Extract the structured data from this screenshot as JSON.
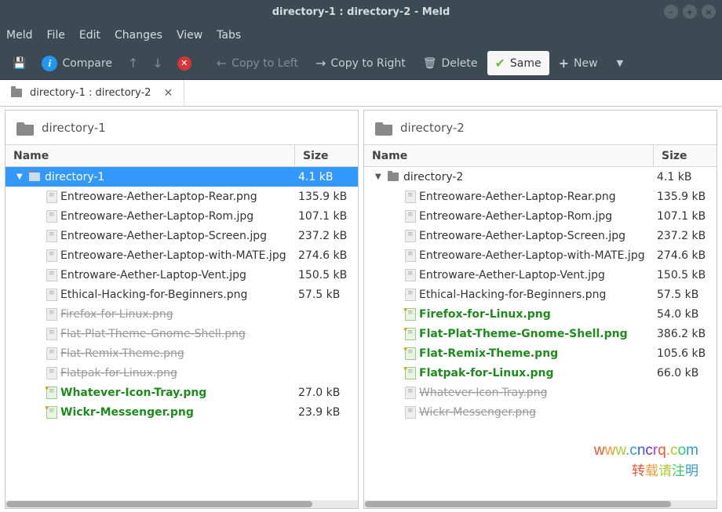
{
  "window": {
    "title": "directory-1 : directory-2 - Meld"
  },
  "menubar": {
    "items": [
      "Meld",
      "File",
      "Edit",
      "Changes",
      "View",
      "Tabs"
    ]
  },
  "toolbar": {
    "compare": "Compare",
    "copy_left": "Copy to Left",
    "copy_right": "Copy to Right",
    "delete": "Delete",
    "same": "Same",
    "new": "New"
  },
  "tab": {
    "label": "directory-1 : directory-2"
  },
  "panels": {
    "left": {
      "header": "directory-1",
      "cols": {
        "name": "Name",
        "size": "Size"
      },
      "root": {
        "name": "directory-1",
        "size": "4.1 kB"
      },
      "files": [
        {
          "name": "Entreoware-Aether-Laptop-Rear.png",
          "size": "135.9 kB",
          "state": "same"
        },
        {
          "name": "Entreoware-Aether-Laptop-Rom.jpg",
          "size": "107.1 kB",
          "state": "same"
        },
        {
          "name": "Entreoware-Aether-Laptop-Screen.jpg",
          "size": "237.2 kB",
          "state": "same"
        },
        {
          "name": "Entreoware-Aether-Laptop-with-MATE.jpg",
          "size": "274.6 kB",
          "state": "same"
        },
        {
          "name": "Entroware-Aether-Laptop-Vent.jpg",
          "size": "150.5 kB",
          "state": "same"
        },
        {
          "name": "Ethical-Hacking-for-Beginners.png",
          "size": "57.5 kB",
          "state": "same"
        },
        {
          "name": "Firefox-for-Linux.png",
          "size": "",
          "state": "deleted"
        },
        {
          "name": "Flat-Plat-Theme-Gnome-Shell.png",
          "size": "",
          "state": "deleted"
        },
        {
          "name": "Flat-Remix-Theme.png",
          "size": "",
          "state": "deleted"
        },
        {
          "name": "Flatpak-for-Linux.png",
          "size": "",
          "state": "deleted"
        },
        {
          "name": "Whatever-Icon-Tray.png",
          "size": "27.0 kB",
          "state": "new"
        },
        {
          "name": "Wickr-Messenger.png",
          "size": "23.9 kB",
          "state": "new"
        }
      ]
    },
    "right": {
      "header": "directory-2",
      "cols": {
        "name": "Name",
        "size": "Size"
      },
      "root": {
        "name": "directory-2",
        "size": "4.1 kB"
      },
      "files": [
        {
          "name": "Entreoware-Aether-Laptop-Rear.png",
          "size": "135.9 kB",
          "state": "same"
        },
        {
          "name": "Entreoware-Aether-Laptop-Rom.jpg",
          "size": "107.1 kB",
          "state": "same"
        },
        {
          "name": "Entreoware-Aether-Laptop-Screen.jpg",
          "size": "237.2 kB",
          "state": "same"
        },
        {
          "name": "Entreoware-Aether-Laptop-with-MATE.jpg",
          "size": "274.6 kB",
          "state": "same"
        },
        {
          "name": "Entroware-Aether-Laptop-Vent.jpg",
          "size": "150.5 kB",
          "state": "same"
        },
        {
          "name": "Ethical-Hacking-for-Beginners.png",
          "size": "57.5 kB",
          "state": "same"
        },
        {
          "name": "Firefox-for-Linux.png",
          "size": "54.0 kB",
          "state": "new"
        },
        {
          "name": "Flat-Plat-Theme-Gnome-Shell.png",
          "size": "386.2 kB",
          "state": "new"
        },
        {
          "name": "Flat-Remix-Theme.png",
          "size": "105.6 kB",
          "state": "new"
        },
        {
          "name": "Flatpak-for-Linux.png",
          "size": "66.0 kB",
          "state": "new"
        },
        {
          "name": "Whatever-Icon-Tray.png",
          "size": "",
          "state": "deleted"
        },
        {
          "name": "Wickr-Messenger.png",
          "size": "",
          "state": "deleted"
        }
      ]
    }
  },
  "watermark": {
    "url": "www.cncrq.com",
    "note": "转载请注明"
  }
}
